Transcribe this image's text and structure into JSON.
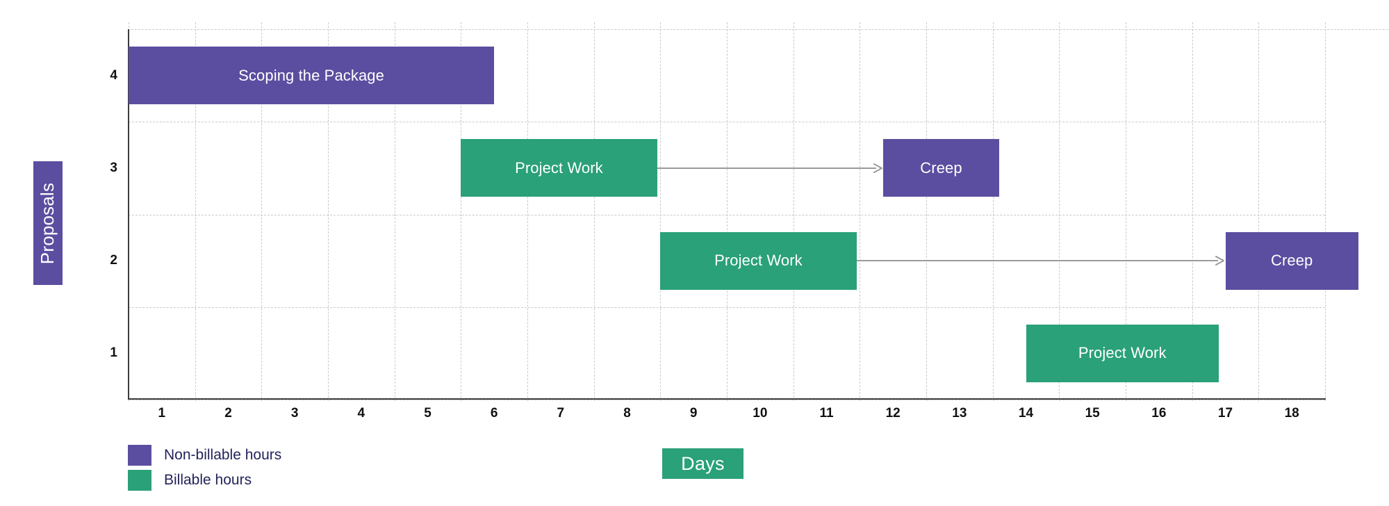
{
  "chart_data": {
    "type": "bar",
    "chart_style": "gantt",
    "title": "",
    "xlabel": "Days",
    "ylabel": "Proposals",
    "xlim": [
      0,
      18
    ],
    "ylim": [
      0.5,
      4.5
    ],
    "grid": true,
    "legend_position": "bottom-left",
    "x_tick_labels": [
      "1",
      "2",
      "3",
      "4",
      "5",
      "6",
      "7",
      "8",
      "9",
      "10",
      "11",
      "12",
      "13",
      "14",
      "15",
      "16",
      "17",
      "18"
    ],
    "y_tick_labels": [
      "1",
      "2",
      "3",
      "4"
    ],
    "legend": [
      {
        "label": "Non-billable hours",
        "color": "#5b4ea0"
      },
      {
        "label": "Billable hours",
        "color": "#2aa178"
      }
    ],
    "colors": {
      "non_billable": "#5b4ea0",
      "billable": "#2aa178",
      "connector": "#9a9a9a",
      "grid": "#c9c9c9",
      "axis": "#3c3c3c",
      "legend_text": "#23235b",
      "background": "#ffffff"
    },
    "tasks": [
      {
        "row": 4,
        "label": "Scoping the Package",
        "category": "non-billable",
        "color": "#5b4ea0",
        "start": 0.0,
        "end": 5.5
      },
      {
        "row": 3,
        "label": "Project Work",
        "category": "billable",
        "color": "#2aa178",
        "start": 5.0,
        "end": 7.95
      },
      {
        "row": 3,
        "label": "Creep",
        "category": "non-billable",
        "color": "#5b4ea0",
        "start": 11.35,
        "end": 13.1
      },
      {
        "row": 2,
        "label": "Project Work",
        "category": "billable",
        "color": "#2aa178",
        "start": 8.0,
        "end": 10.95
      },
      {
        "row": 2,
        "label": "Creep",
        "category": "non-billable",
        "color": "#5b4ea0",
        "start": 16.5,
        "end": 18.5
      },
      {
        "row": 1,
        "label": "Project Work",
        "category": "billable",
        "color": "#2aa178",
        "start": 13.5,
        "end": 16.4
      }
    ],
    "connectors": [
      {
        "row": 3,
        "from": 7.95,
        "to": 11.35
      },
      {
        "row": 2,
        "from": 10.95,
        "to": 16.5
      }
    ]
  }
}
